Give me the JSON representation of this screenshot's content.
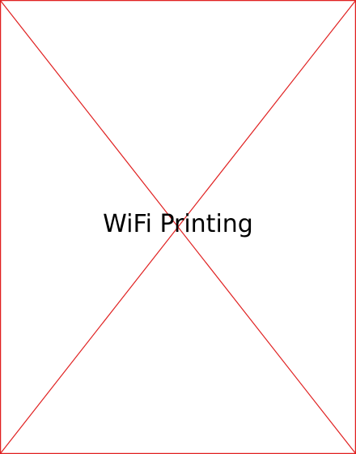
{
  "placeholder": {
    "caption": "WiFi Printing",
    "border_color": "#e02020",
    "text_color": "#000000",
    "background_color": "#ffffff",
    "graphic": "broken-image-cross"
  }
}
